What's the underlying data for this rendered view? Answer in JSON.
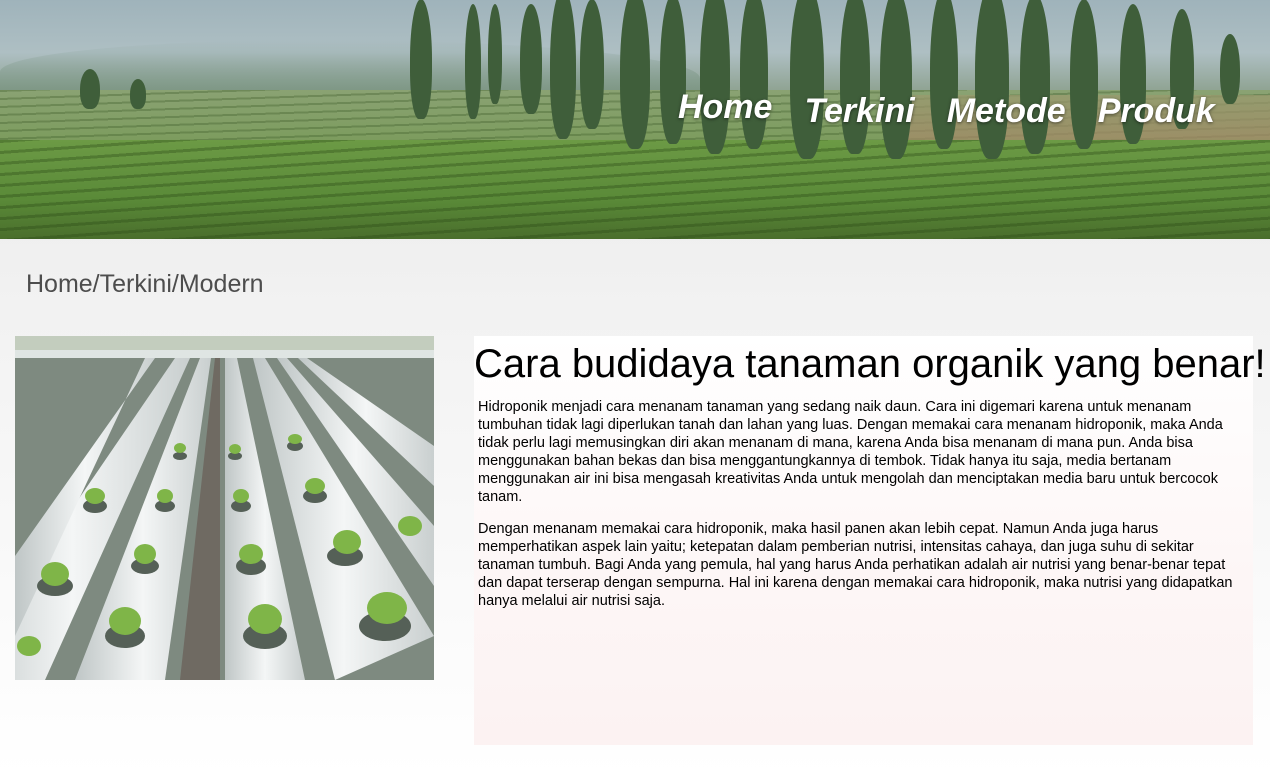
{
  "header": {
    "nav": [
      "Home",
      "Terkini",
      "Metode",
      "Produk"
    ]
  },
  "breadcrumb": "Home/Terkini/Modern",
  "article": {
    "title": "Cara budidaya tanaman organik yang benar!",
    "paragraphs": [
      "Hidroponik menjadi cara menanam tanaman yang sedang naik daun. Cara ini digemari karena untuk menanam tumbuhan tidak lagi diperlukan tanah dan lahan yang luas. Dengan memakai cara menanam hidroponik, maka Anda tidak perlu lagi memusingkan diri akan menanam di mana, karena Anda bisa menanam di mana pun. Anda bisa menggunakan bahan bekas dan bisa menggantungkannya di tembok. Tidak hanya itu saja, media bertanam menggunakan air ini bisa mengasah kreativitas Anda untuk mengolah dan menciptakan media baru untuk bercocok tanam.",
      "Dengan menanam memakai cara hidroponik, maka hasil panen akan lebih cepat. Namun Anda juga harus memperhatikan aspek lain yaitu; ketepatan dalam pemberian nutrisi, intensitas cahaya, dan juga suhu di sekitar tanaman tumbuh. Bagi Anda yang pemula, hal yang harus Anda perhatikan adalah air nutrisi yang benar-benar tepat dan dapat terserap dengan sempurna. Hal ini karena dengan memakai cara hidroponik, maka nutrisi yang didapatkan hanya melalui air nutrisi saja."
    ]
  },
  "colors": {
    "nav_text": "#ffffff",
    "breadcrumb_text": "#4d4d4d",
    "article_bg": "#fdf6f6"
  }
}
